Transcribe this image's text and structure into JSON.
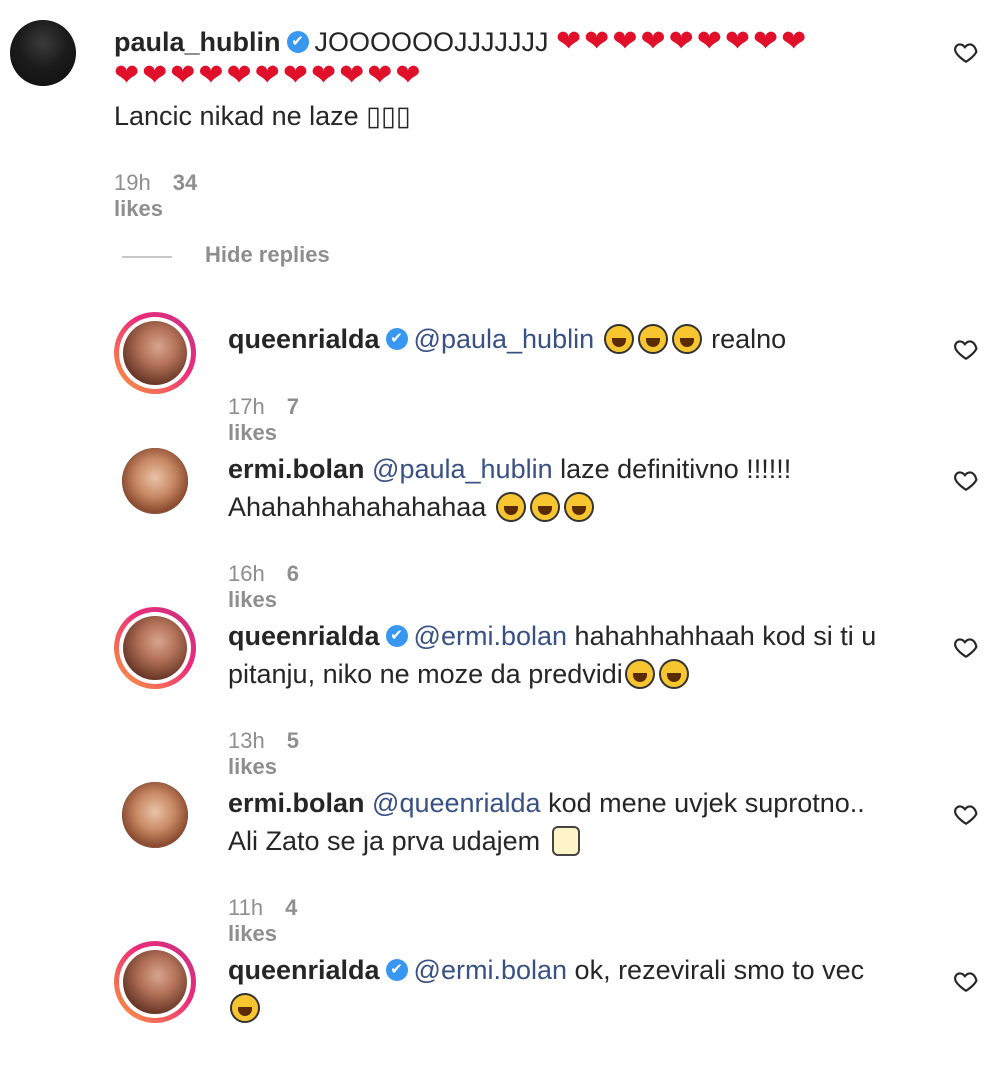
{
  "comments": [
    {
      "username": "paula_hublin",
      "line1": "JOOOOOOJJJJJJJ",
      "hearts1": "❤❤❤❤❤❤❤❤❤",
      "hearts2": "❤❤❤❤❤❤❤❤❤❤❤",
      "line3": "Lancic nikad ne laze ",
      "line3_tail": "▯▯▯",
      "time": "19h",
      "likes": "34 likes"
    }
  ],
  "hide_replies": "Hide replies",
  "replies": [
    {
      "username": "queenrialda",
      "mention": "@paula_hublin",
      "text1": "realno",
      "time": "17h",
      "likes": "7 likes"
    },
    {
      "username": "ermi.bolan",
      "mention": "@paula_hublin",
      "text1": "laze definitivno !!!!!!",
      "text2": "Ahahahhahahahahaa",
      "time": "16h",
      "likes": "6 likes"
    },
    {
      "username": "queenrialda",
      "mention": "@ermi.bolan",
      "text1": "hahahhahhaah kod si ti u",
      "text2": "pitanju, niko ne moze da predvidi",
      "time": "13h",
      "likes": "5 likes"
    },
    {
      "username": "ermi.bolan",
      "mention": "@queenrialda",
      "text1": "kod mene uvjek suprotno..",
      "text2": "Ali Zato se ja prva udajem",
      "time": "11h",
      "likes": "4 likes"
    },
    {
      "username": "queenrialda",
      "mention": "@ermi.bolan",
      "text1": "ok, rezevirali smo to vec"
    }
  ],
  "icons": {
    "verified": "✔",
    "like": "heart-outline-icon"
  },
  "colors": {
    "mention": "#385185",
    "verified": "#3897f0",
    "heart": "#e0102b",
    "meta": "#8e8e8e"
  }
}
